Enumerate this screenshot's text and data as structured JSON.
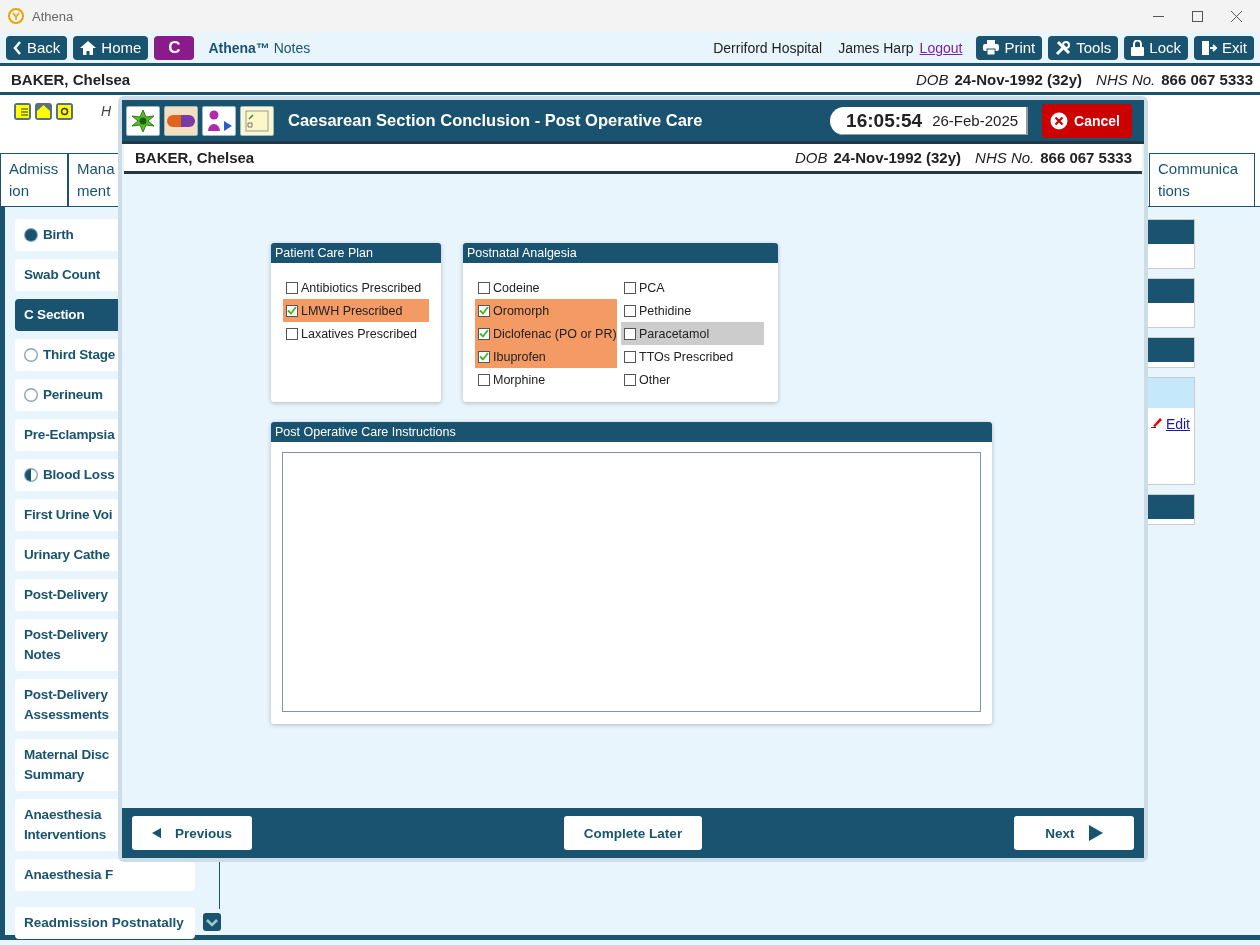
{
  "window": {
    "title": "Athena"
  },
  "toolbar": {
    "back": "Back",
    "home": "Home",
    "badge": "C",
    "app_name": "**Athena™** Notes",
    "hospital": "Derriford Hospital",
    "user": "James Harp",
    "logout": "Logout",
    "buttons": [
      {
        "kind": "print",
        "label": "Print"
      },
      {
        "kind": "tools",
        "label": "Tools"
      },
      {
        "kind": "lock",
        "label": "Lock"
      },
      {
        "kind": "exit",
        "label": "Exit"
      }
    ]
  },
  "patient": {
    "name": "BAKER, Chelsea",
    "dob_label": "DOB",
    "dob": "24-Nov-1992 (32y)",
    "nhs_label": "NHS No.",
    "nhs": "866 067 5333"
  },
  "info_row": {
    "text": "H"
  },
  "tabs": [
    {
      "lines": [
        "Admiss",
        "ion"
      ]
    },
    {
      "lines": [
        "Mana",
        "ment"
      ]
    }
  ],
  "right_tabs": [
    {
      "lines": [
        "Communica",
        "tions"
      ]
    }
  ],
  "sidebar": {
    "items": [
      {
        "label": "Birth",
        "level": 1,
        "selected": false
      },
      {
        "label": "Swab Count",
        "selected": false
      },
      {
        "label": "C Section",
        "selected": true
      },
      {
        "label": "Third Stage",
        "level": 0,
        "selected": false
      },
      {
        "label": "Perineum",
        "level": 0,
        "selected": false
      },
      {
        "label": "Pre-Eclampsia",
        "selected": false
      },
      {
        "label": "Blood Loss",
        "level": 0.5,
        "selected": false
      },
      {
        "label": "First Urine Voi",
        "selected": false
      },
      {
        "label": "Urinary Cathe",
        "selected": false
      },
      {
        "label": "Post-Delivery",
        "selected": false
      },
      {
        "label": "Post-Delivery Notes",
        "selected": false
      },
      {
        "label": "Post-Delivery Assessments",
        "selected": false
      },
      {
        "label": "Maternal Disc Summary",
        "selected": false
      },
      {
        "label": "Anaesthesia Interventions",
        "selected": false
      },
      {
        "label": "Anaesthesia F",
        "selected": false
      }
    ],
    "bottom_items": [
      {
        "label": "Readmission Postnatally",
        "selected": false
      }
    ]
  },
  "right_panels": [
    {
      "kind": "short"
    },
    {
      "kind": "short"
    },
    {
      "kind": "thin"
    },
    {
      "kind": "edit",
      "link": "Edit"
    },
    {
      "kind": "thin"
    }
  ],
  "modal": {
    "title": "Caesarean Section Conclusion - Post Operative Care",
    "time": "16:05:54",
    "date": "26-Feb-2025",
    "cancel": "Cancel",
    "patient": {
      "name": "BAKER, Chelsea",
      "dob_label": "DOB",
      "dob": "24-Nov-1992 (32y)",
      "nhs_label": "NHS No.",
      "nhs": "866 067 5333"
    },
    "care_plan": {
      "title": "Patient Care Plan",
      "items": [
        {
          "label": "Antibiotics Prescribed",
          "checked": false,
          "focused": false
        },
        {
          "label": "LMWH Prescribed",
          "checked": true,
          "focused": false
        },
        {
          "label": "Laxatives Prescribed",
          "checked": false,
          "focused": false
        }
      ]
    },
    "analgesia": {
      "title": "Postnatal Analgesia",
      "columns": [
        {
          "items": [
            {
              "label": "Codeine",
              "checked": false,
              "focused": false
            },
            {
              "label": "Oromorph",
              "checked": true,
              "focused": false
            },
            {
              "label": "Diclofenac (PO or PR)",
              "checked": true,
              "focused": false
            },
            {
              "label": "Ibuprofen",
              "checked": true,
              "focused": false
            },
            {
              "label": "Morphine",
              "checked": false,
              "focused": false
            }
          ]
        },
        {
          "items": [
            {
              "label": "PCA",
              "checked": false,
              "focused": false
            },
            {
              "label": "Pethidine",
              "checked": false,
              "focused": false
            },
            {
              "label": "Paracetamol",
              "checked": false,
              "focused": true
            },
            {
              "label": "TTOs Prescribed",
              "checked": false,
              "focused": false
            },
            {
              "label": "Other",
              "checked": false,
              "focused": false
            }
          ]
        }
      ]
    },
    "instructions": {
      "title": "Post Operative Care Instructions"
    },
    "footer": {
      "previous": "Previous",
      "complete_later": "Complete Later",
      "next": "Next"
    }
  }
}
